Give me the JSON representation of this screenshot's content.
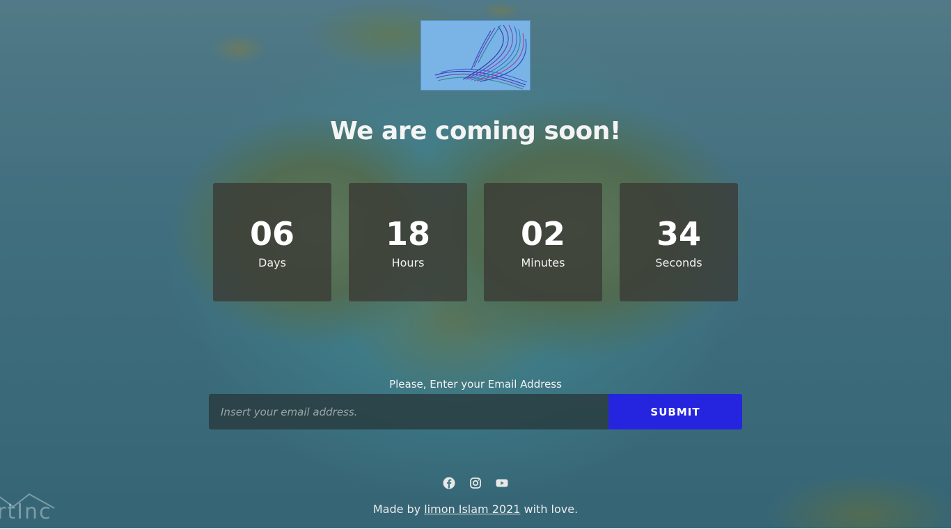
{
  "page": {
    "title": "We are coming soon!"
  },
  "countdown": [
    {
      "value": "06",
      "label": "Days"
    },
    {
      "value": "18",
      "label": "Hours"
    },
    {
      "value": "02",
      "label": "Minutes"
    },
    {
      "value": "34",
      "label": "Seconds"
    }
  ],
  "subscribe": {
    "label": "Please, Enter your Email Address",
    "placeholder": "Insert your email address.",
    "submit_label": "SUBMIT"
  },
  "social": {
    "icons": [
      "facebook-icon",
      "instagram-icon",
      "youtube-icon"
    ]
  },
  "footer": {
    "prefix": "Made by ",
    "link_text": "limon Islam 2021",
    "suffix": " with love."
  },
  "watermark": {
    "text": "rtInc"
  },
  "colors": {
    "submit": "#2525e0",
    "box": "#3a3a34",
    "logo_bg": "#7ab4e6"
  }
}
